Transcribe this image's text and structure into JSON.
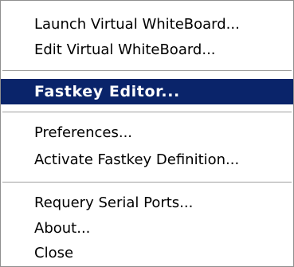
{
  "menu": {
    "groups": [
      {
        "items": [
          {
            "label": "Launch Virtual WhiteBoard..."
          },
          {
            "label": "Edit Virtual WhiteBoard..."
          }
        ]
      },
      {
        "items": [
          {
            "label": "Fastkey Editor...",
            "selected": true
          }
        ]
      },
      {
        "items": [
          {
            "label": "Preferences..."
          },
          {
            "label": "Activate Fastkey Definition..."
          }
        ]
      },
      {
        "items": [
          {
            "label": "Requery Serial Ports..."
          },
          {
            "label": "About..."
          },
          {
            "label": "Close"
          }
        ]
      }
    ]
  },
  "colors": {
    "highlight_background": "#0a246a",
    "highlight_text": "#ffffff",
    "menu_background": "#ffffff"
  }
}
